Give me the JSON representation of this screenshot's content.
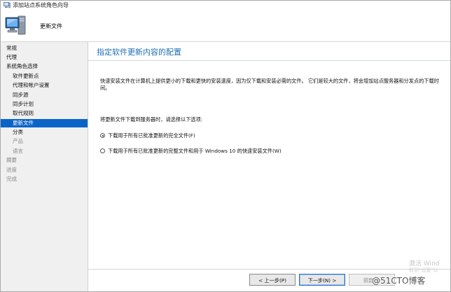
{
  "window": {
    "title": "添加站点系统角色向导"
  },
  "header": {
    "title": "更新文件",
    "icon": "computer-icon"
  },
  "sidebar": {
    "items": [
      {
        "label": "常规",
        "level": 1,
        "state": "normal"
      },
      {
        "label": "代理",
        "level": 1,
        "state": "normal"
      },
      {
        "label": "系统角色选择",
        "level": 1,
        "state": "normal"
      },
      {
        "label": "软件更新点",
        "level": 2,
        "state": "normal"
      },
      {
        "label": "代理和帐户设置",
        "level": 2,
        "state": "normal"
      },
      {
        "label": "同步源",
        "level": 2,
        "state": "normal"
      },
      {
        "label": "同步计划",
        "level": 2,
        "state": "normal"
      },
      {
        "label": "取代规则",
        "level": 2,
        "state": "normal"
      },
      {
        "label": "更新文件",
        "level": 2,
        "state": "active"
      },
      {
        "label": "分类",
        "level": 2,
        "state": "normal"
      },
      {
        "label": "产品",
        "level": 2,
        "state": "disabled"
      },
      {
        "label": "语言",
        "level": 2,
        "state": "disabled"
      },
      {
        "label": "摘要",
        "level": 1,
        "state": "disabled"
      },
      {
        "label": "进度",
        "level": 1,
        "state": "disabled"
      },
      {
        "label": "完成",
        "level": 1,
        "state": "disabled"
      }
    ]
  },
  "content": {
    "title": "指定软件更新内容的配置",
    "description": "快速安装文件在计算机上提供更小的下载和更快的安装速度，因为仅下载和安装必需的文件。  它们是较大的文件，将会增加站点服务器和分发点的下载时间。",
    "prompt": "将更新文件下载到服务器时，请选择以下选项:",
    "options": [
      {
        "label": "下载用于所有已批准更新的完全文件(F)",
        "checked": true
      },
      {
        "label": "下载用于所有已批准更新的完整文件和用于 Windows 10 的快速安装文件(W)",
        "checked": false
      }
    ]
  },
  "footer": {
    "prev_label": "< 上一步(P)",
    "next_label": "下一步(N) >",
    "summary_label": "摘要(S)"
  },
  "watermark": {
    "line1": "激活 Wind",
    "line2": "转到\"设置\"以",
    "blog": "@51CTO博客"
  },
  "colors": {
    "accent": "#1e6fb5",
    "selected": "#0a64c8"
  }
}
